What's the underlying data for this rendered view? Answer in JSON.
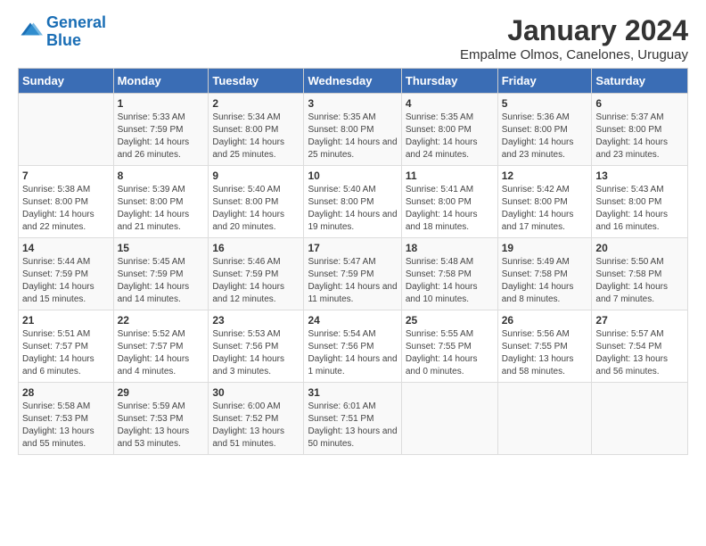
{
  "header": {
    "logo_line1": "General",
    "logo_line2": "Blue",
    "title": "January 2024",
    "subtitle": "Empalme Olmos, Canelones, Uruguay"
  },
  "days_of_week": [
    "Sunday",
    "Monday",
    "Tuesday",
    "Wednesday",
    "Thursday",
    "Friday",
    "Saturday"
  ],
  "weeks": [
    [
      {
        "day": "",
        "info": ""
      },
      {
        "day": "1",
        "info": "Sunrise: 5:33 AM\nSunset: 7:59 PM\nDaylight: 14 hours\nand 26 minutes."
      },
      {
        "day": "2",
        "info": "Sunrise: 5:34 AM\nSunset: 8:00 PM\nDaylight: 14 hours\nand 25 minutes."
      },
      {
        "day": "3",
        "info": "Sunrise: 5:35 AM\nSunset: 8:00 PM\nDaylight: 14 hours\nand 25 minutes."
      },
      {
        "day": "4",
        "info": "Sunrise: 5:35 AM\nSunset: 8:00 PM\nDaylight: 14 hours\nand 24 minutes."
      },
      {
        "day": "5",
        "info": "Sunrise: 5:36 AM\nSunset: 8:00 PM\nDaylight: 14 hours\nand 23 minutes."
      },
      {
        "day": "6",
        "info": "Sunrise: 5:37 AM\nSunset: 8:00 PM\nDaylight: 14 hours\nand 23 minutes."
      }
    ],
    [
      {
        "day": "7",
        "info": "Sunrise: 5:38 AM\nSunset: 8:00 PM\nDaylight: 14 hours\nand 22 minutes."
      },
      {
        "day": "8",
        "info": "Sunrise: 5:39 AM\nSunset: 8:00 PM\nDaylight: 14 hours\nand 21 minutes."
      },
      {
        "day": "9",
        "info": "Sunrise: 5:40 AM\nSunset: 8:00 PM\nDaylight: 14 hours\nand 20 minutes."
      },
      {
        "day": "10",
        "info": "Sunrise: 5:40 AM\nSunset: 8:00 PM\nDaylight: 14 hours\nand 19 minutes."
      },
      {
        "day": "11",
        "info": "Sunrise: 5:41 AM\nSunset: 8:00 PM\nDaylight: 14 hours\nand 18 minutes."
      },
      {
        "day": "12",
        "info": "Sunrise: 5:42 AM\nSunset: 8:00 PM\nDaylight: 14 hours\nand 17 minutes."
      },
      {
        "day": "13",
        "info": "Sunrise: 5:43 AM\nSunset: 8:00 PM\nDaylight: 14 hours\nand 16 minutes."
      }
    ],
    [
      {
        "day": "14",
        "info": "Sunrise: 5:44 AM\nSunset: 7:59 PM\nDaylight: 14 hours\nand 15 minutes."
      },
      {
        "day": "15",
        "info": "Sunrise: 5:45 AM\nSunset: 7:59 PM\nDaylight: 14 hours\nand 14 minutes."
      },
      {
        "day": "16",
        "info": "Sunrise: 5:46 AM\nSunset: 7:59 PM\nDaylight: 14 hours\nand 12 minutes."
      },
      {
        "day": "17",
        "info": "Sunrise: 5:47 AM\nSunset: 7:59 PM\nDaylight: 14 hours\nand 11 minutes."
      },
      {
        "day": "18",
        "info": "Sunrise: 5:48 AM\nSunset: 7:58 PM\nDaylight: 14 hours\nand 10 minutes."
      },
      {
        "day": "19",
        "info": "Sunrise: 5:49 AM\nSunset: 7:58 PM\nDaylight: 14 hours\nand 8 minutes."
      },
      {
        "day": "20",
        "info": "Sunrise: 5:50 AM\nSunset: 7:58 PM\nDaylight: 14 hours\nand 7 minutes."
      }
    ],
    [
      {
        "day": "21",
        "info": "Sunrise: 5:51 AM\nSunset: 7:57 PM\nDaylight: 14 hours\nand 6 minutes."
      },
      {
        "day": "22",
        "info": "Sunrise: 5:52 AM\nSunset: 7:57 PM\nDaylight: 14 hours\nand 4 minutes."
      },
      {
        "day": "23",
        "info": "Sunrise: 5:53 AM\nSunset: 7:56 PM\nDaylight: 14 hours\nand 3 minutes."
      },
      {
        "day": "24",
        "info": "Sunrise: 5:54 AM\nSunset: 7:56 PM\nDaylight: 14 hours\nand 1 minute."
      },
      {
        "day": "25",
        "info": "Sunrise: 5:55 AM\nSunset: 7:55 PM\nDaylight: 14 hours\nand 0 minutes."
      },
      {
        "day": "26",
        "info": "Sunrise: 5:56 AM\nSunset: 7:55 PM\nDaylight: 13 hours\nand 58 minutes."
      },
      {
        "day": "27",
        "info": "Sunrise: 5:57 AM\nSunset: 7:54 PM\nDaylight: 13 hours\nand 56 minutes."
      }
    ],
    [
      {
        "day": "28",
        "info": "Sunrise: 5:58 AM\nSunset: 7:53 PM\nDaylight: 13 hours\nand 55 minutes."
      },
      {
        "day": "29",
        "info": "Sunrise: 5:59 AM\nSunset: 7:53 PM\nDaylight: 13 hours\nand 53 minutes."
      },
      {
        "day": "30",
        "info": "Sunrise: 6:00 AM\nSunset: 7:52 PM\nDaylight: 13 hours\nand 51 minutes."
      },
      {
        "day": "31",
        "info": "Sunrise: 6:01 AM\nSunset: 7:51 PM\nDaylight: 13 hours\nand 50 minutes."
      },
      {
        "day": "",
        "info": ""
      },
      {
        "day": "",
        "info": ""
      },
      {
        "day": "",
        "info": ""
      }
    ]
  ]
}
